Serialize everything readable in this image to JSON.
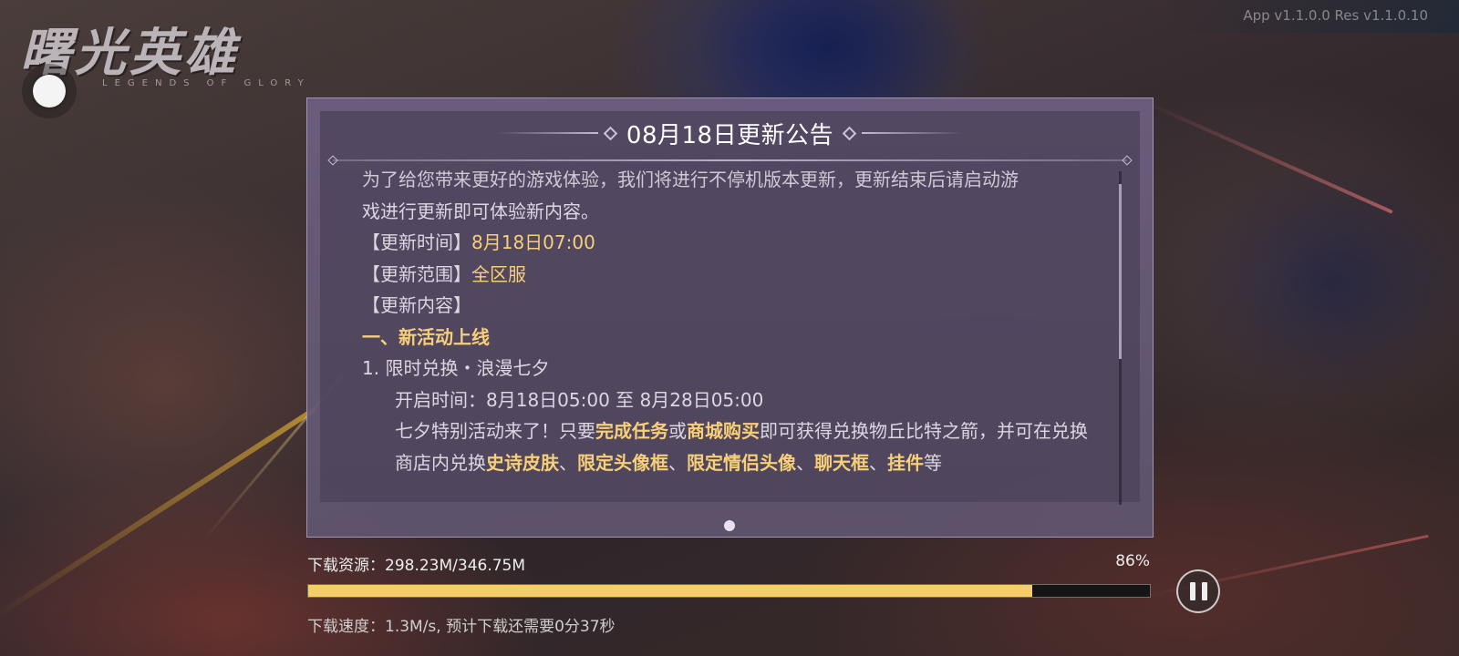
{
  "version": "App v1.1.0.0  Res v1.1.0.10",
  "logo": {
    "title": "曙光英雄",
    "subtitle": "LEGENDS OF GLORY"
  },
  "announcement": {
    "title": "08月18日更新公告",
    "cut_line": "为了给您带来更好的游戏体验，我们将进行不停机版本更新，更新结束后请启动游",
    "intro": "戏进行更新即可体验新内容。",
    "time_label": "【更新时间】",
    "time_value": "8月18日07:00",
    "range_label": "【更新范围】",
    "range_value": "全区服",
    "content_label": "【更新内容】",
    "section_heading": "一、新活动上线",
    "item_title": "1. 限时兑换・浪漫七夕",
    "open_time": "开启时间：8月18日05:00 至 8月28日05:00",
    "desc": {
      "p1": "七夕特别活动来了！只要",
      "h1": "完成任务",
      "p2": "或",
      "h2": "商城购买",
      "p3": "即可获得兑换物丘比特之箭，并可在兑换商店内兑换",
      "h3": "史诗皮肤",
      "s1": "、",
      "h4": "限定头像框",
      "s2": "、",
      "h5": "限定情侣头像",
      "s3": "、",
      "h6": "聊天框",
      "s4": "、",
      "h7": "挂件",
      "p4": "等"
    },
    "scroll_position": 0.08,
    "page_count": 1,
    "page_current": 1
  },
  "download": {
    "label": "下载资源：298.23M/346.75M",
    "percent_text": "86%",
    "progress": 0.86,
    "speed": "下载速度：1.3M/s, 预计下载还需要0分37秒"
  },
  "colors": {
    "highlight": "#f7cf78",
    "progress_fill": "#f6cd6a",
    "panel": "#6e5f82"
  },
  "icons": {
    "pause": "pause-icon",
    "float": "floating-assistant-icon"
  }
}
